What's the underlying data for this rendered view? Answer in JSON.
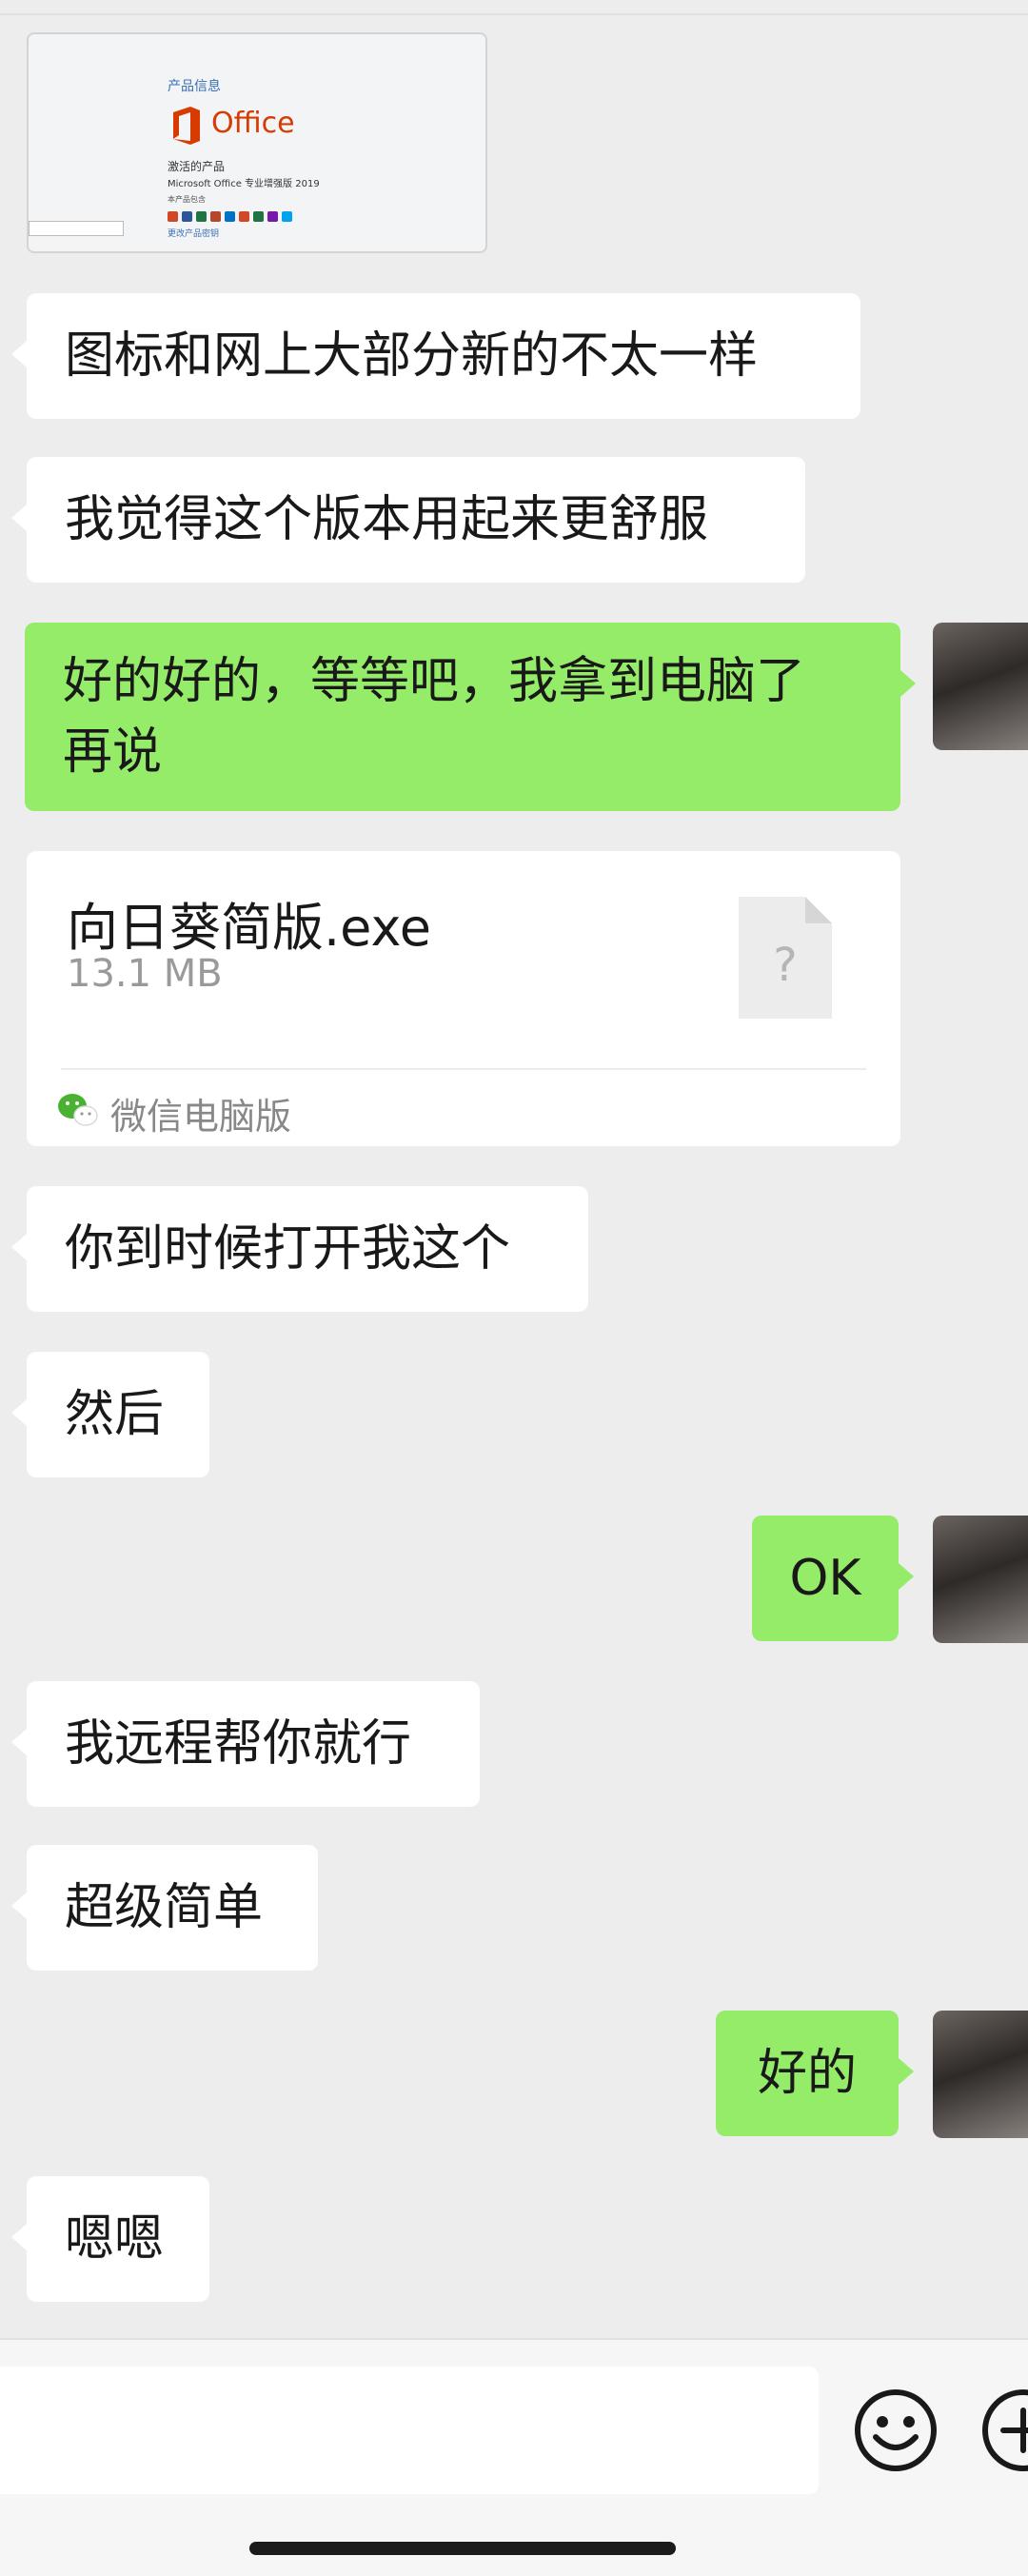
{
  "screenshot_card": {
    "heading": "产品信息",
    "logo": "Office",
    "status": "激活的产品",
    "product": "Microsoft Office 专业增强版 2019",
    "includes": "本产品包含",
    "link": "更改产品密钥"
  },
  "messages": [
    {
      "side": "in",
      "text": "图标和网上大部分新的不太一样"
    },
    {
      "side": "in",
      "text": "我觉得这个版本用起来更舒服"
    },
    {
      "side": "out",
      "line1": "好的好的，等等吧，我拿到电脑了",
      "line2": "再说"
    },
    {
      "side": "in",
      "text": "你到时候打开我这个"
    },
    {
      "side": "in",
      "text": "然后"
    },
    {
      "side": "out",
      "text": "OK"
    },
    {
      "side": "in",
      "text": "我远程帮你就行"
    },
    {
      "side": "in",
      "text": "超级简单"
    },
    {
      "side": "out",
      "text": "好的"
    },
    {
      "side": "in",
      "text": "嗯嗯"
    }
  ],
  "file": {
    "name": "向日葵简版.exe",
    "size": "13.1 MB",
    "source": "微信电脑版",
    "icon": "unknown-file-icon"
  },
  "input_bar": {
    "value": "",
    "emoji_icon": "smiley-face-icon",
    "plus_icon": "plus-circle-icon"
  },
  "colors": {
    "background": "#ededed",
    "outgoing_bubble": "#95ec69",
    "incoming_bubble": "#ffffff",
    "office_brand": "#d83b01"
  }
}
